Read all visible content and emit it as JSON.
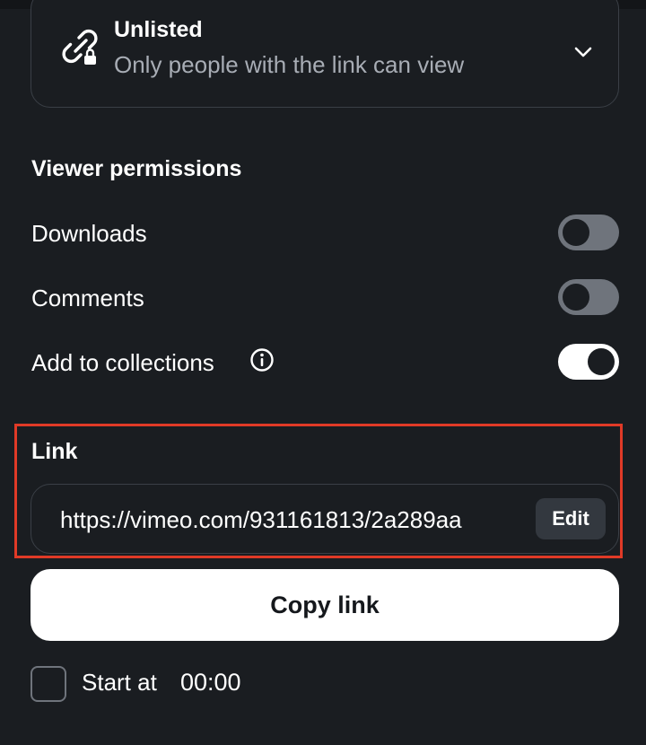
{
  "privacy": {
    "title": "Unlisted",
    "description": "Only people with the link can view",
    "icon": "link-lock-icon"
  },
  "viewer_permissions": {
    "heading": "Viewer permissions",
    "items": [
      {
        "label": "Downloads",
        "enabled": false
      },
      {
        "label": "Comments",
        "enabled": false
      },
      {
        "label": "Add to collections",
        "enabled": true,
        "has_info_icon": true
      }
    ]
  },
  "link": {
    "heading": "Link",
    "url": "https://vimeo.com/931161813/2a289aa",
    "edit_label": "Edit",
    "copy_label": "Copy link"
  },
  "start_at": {
    "label": "Start at",
    "time": "00:00",
    "checked": false
  },
  "colors": {
    "background": "#1a1d21",
    "highlight": "#e03a27",
    "toggle_off": "#6f747c",
    "toggle_on": "#ffffff"
  }
}
